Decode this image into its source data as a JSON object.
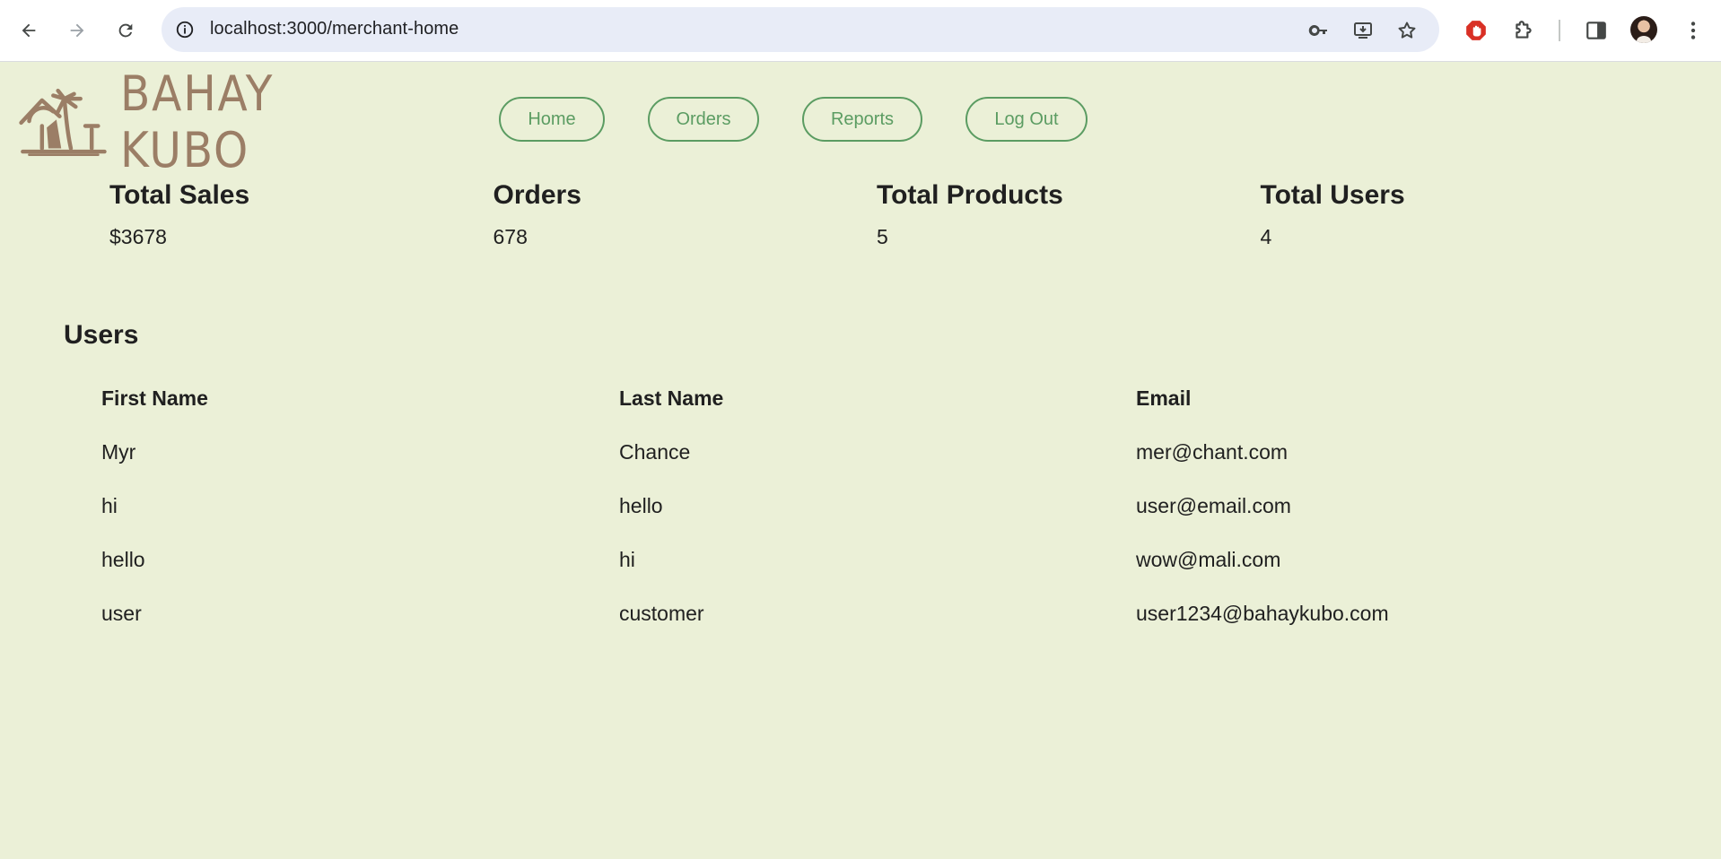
{
  "browser": {
    "url": "localhost:3000/merchant-home",
    "icons": {
      "back": "arrow-left-icon",
      "forward": "arrow-right-icon",
      "reload": "reload-icon",
      "site_info": "info-icon",
      "password": "key-icon",
      "install": "install-icon",
      "bookmark": "star-icon",
      "adblock": "stop-hand-icon",
      "extensions": "puzzle-icon",
      "side_panel": "side-panel-icon",
      "menu": "kebab-menu-icon"
    }
  },
  "brand": {
    "name": "BAHAY KUBO",
    "color": "#9b7e66"
  },
  "nav": {
    "accent": "#5b9c62",
    "items": [
      {
        "label": "Home"
      },
      {
        "label": "Orders"
      },
      {
        "label": "Reports"
      },
      {
        "label": "Log Out"
      }
    ]
  },
  "stats": [
    {
      "title": "Total Sales",
      "value": "$3678"
    },
    {
      "title": "Orders",
      "value": "678"
    },
    {
      "title": "Total Products",
      "value": "5"
    },
    {
      "title": "Total Users",
      "value": "4"
    }
  ],
  "users": {
    "title": "Users",
    "columns": [
      "First Name",
      "Last Name",
      "Email"
    ],
    "rows": [
      [
        "Myr",
        "Chance",
        "mer@chant.com"
      ],
      [
        "hi",
        "hello",
        "user@email.com"
      ],
      [
        "hello",
        "hi",
        "wow@mali.com"
      ],
      [
        "user",
        "customer",
        "user1234@bahaykubo.com"
      ]
    ]
  },
  "colors": {
    "page_background": "#ebf0d7",
    "text": "#202020"
  }
}
